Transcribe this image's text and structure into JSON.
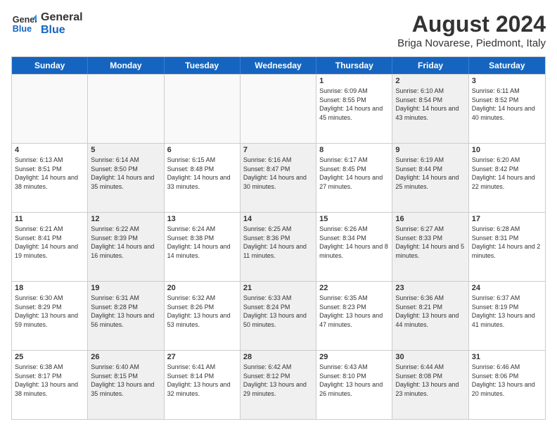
{
  "logo": {
    "line1": "General",
    "line2": "Blue"
  },
  "title": "August 2024",
  "subtitle": "Briga Novarese, Piedmont, Italy",
  "header_days": [
    "Sunday",
    "Monday",
    "Tuesday",
    "Wednesday",
    "Thursday",
    "Friday",
    "Saturday"
  ],
  "rows": [
    [
      {
        "day": "",
        "info": "",
        "shaded": false,
        "empty": true
      },
      {
        "day": "",
        "info": "",
        "shaded": false,
        "empty": true
      },
      {
        "day": "",
        "info": "",
        "shaded": false,
        "empty": true
      },
      {
        "day": "",
        "info": "",
        "shaded": false,
        "empty": true
      },
      {
        "day": "1",
        "info": "Sunrise: 6:09 AM\nSunset: 8:55 PM\nDaylight: 14 hours and 45 minutes.",
        "shaded": false,
        "empty": false
      },
      {
        "day": "2",
        "info": "Sunrise: 6:10 AM\nSunset: 8:54 PM\nDaylight: 14 hours and 43 minutes.",
        "shaded": true,
        "empty": false
      },
      {
        "day": "3",
        "info": "Sunrise: 6:11 AM\nSunset: 8:52 PM\nDaylight: 14 hours and 40 minutes.",
        "shaded": false,
        "empty": false
      }
    ],
    [
      {
        "day": "4",
        "info": "Sunrise: 6:13 AM\nSunset: 8:51 PM\nDaylight: 14 hours and 38 minutes.",
        "shaded": false,
        "empty": false
      },
      {
        "day": "5",
        "info": "Sunrise: 6:14 AM\nSunset: 8:50 PM\nDaylight: 14 hours and 35 minutes.",
        "shaded": true,
        "empty": false
      },
      {
        "day": "6",
        "info": "Sunrise: 6:15 AM\nSunset: 8:48 PM\nDaylight: 14 hours and 33 minutes.",
        "shaded": false,
        "empty": false
      },
      {
        "day": "7",
        "info": "Sunrise: 6:16 AM\nSunset: 8:47 PM\nDaylight: 14 hours and 30 minutes.",
        "shaded": true,
        "empty": false
      },
      {
        "day": "8",
        "info": "Sunrise: 6:17 AM\nSunset: 8:45 PM\nDaylight: 14 hours and 27 minutes.",
        "shaded": false,
        "empty": false
      },
      {
        "day": "9",
        "info": "Sunrise: 6:19 AM\nSunset: 8:44 PM\nDaylight: 14 hours and 25 minutes.",
        "shaded": true,
        "empty": false
      },
      {
        "day": "10",
        "info": "Sunrise: 6:20 AM\nSunset: 8:42 PM\nDaylight: 14 hours and 22 minutes.",
        "shaded": false,
        "empty": false
      }
    ],
    [
      {
        "day": "11",
        "info": "Sunrise: 6:21 AM\nSunset: 8:41 PM\nDaylight: 14 hours and 19 minutes.",
        "shaded": false,
        "empty": false
      },
      {
        "day": "12",
        "info": "Sunrise: 6:22 AM\nSunset: 8:39 PM\nDaylight: 14 hours and 16 minutes.",
        "shaded": true,
        "empty": false
      },
      {
        "day": "13",
        "info": "Sunrise: 6:24 AM\nSunset: 8:38 PM\nDaylight: 14 hours and 14 minutes.",
        "shaded": false,
        "empty": false
      },
      {
        "day": "14",
        "info": "Sunrise: 6:25 AM\nSunset: 8:36 PM\nDaylight: 14 hours and 11 minutes.",
        "shaded": true,
        "empty": false
      },
      {
        "day": "15",
        "info": "Sunrise: 6:26 AM\nSunset: 8:34 PM\nDaylight: 14 hours and 8 minutes.",
        "shaded": false,
        "empty": false
      },
      {
        "day": "16",
        "info": "Sunrise: 6:27 AM\nSunset: 8:33 PM\nDaylight: 14 hours and 5 minutes.",
        "shaded": true,
        "empty": false
      },
      {
        "day": "17",
        "info": "Sunrise: 6:28 AM\nSunset: 8:31 PM\nDaylight: 14 hours and 2 minutes.",
        "shaded": false,
        "empty": false
      }
    ],
    [
      {
        "day": "18",
        "info": "Sunrise: 6:30 AM\nSunset: 8:29 PM\nDaylight: 13 hours and 59 minutes.",
        "shaded": false,
        "empty": false
      },
      {
        "day": "19",
        "info": "Sunrise: 6:31 AM\nSunset: 8:28 PM\nDaylight: 13 hours and 56 minutes.",
        "shaded": true,
        "empty": false
      },
      {
        "day": "20",
        "info": "Sunrise: 6:32 AM\nSunset: 8:26 PM\nDaylight: 13 hours and 53 minutes.",
        "shaded": false,
        "empty": false
      },
      {
        "day": "21",
        "info": "Sunrise: 6:33 AM\nSunset: 8:24 PM\nDaylight: 13 hours and 50 minutes.",
        "shaded": true,
        "empty": false
      },
      {
        "day": "22",
        "info": "Sunrise: 6:35 AM\nSunset: 8:23 PM\nDaylight: 13 hours and 47 minutes.",
        "shaded": false,
        "empty": false
      },
      {
        "day": "23",
        "info": "Sunrise: 6:36 AM\nSunset: 8:21 PM\nDaylight: 13 hours and 44 minutes.",
        "shaded": true,
        "empty": false
      },
      {
        "day": "24",
        "info": "Sunrise: 6:37 AM\nSunset: 8:19 PM\nDaylight: 13 hours and 41 minutes.",
        "shaded": false,
        "empty": false
      }
    ],
    [
      {
        "day": "25",
        "info": "Sunrise: 6:38 AM\nSunset: 8:17 PM\nDaylight: 13 hours and 38 minutes.",
        "shaded": false,
        "empty": false
      },
      {
        "day": "26",
        "info": "Sunrise: 6:40 AM\nSunset: 8:15 PM\nDaylight: 13 hours and 35 minutes.",
        "shaded": true,
        "empty": false
      },
      {
        "day": "27",
        "info": "Sunrise: 6:41 AM\nSunset: 8:14 PM\nDaylight: 13 hours and 32 minutes.",
        "shaded": false,
        "empty": false
      },
      {
        "day": "28",
        "info": "Sunrise: 6:42 AM\nSunset: 8:12 PM\nDaylight: 13 hours and 29 minutes.",
        "shaded": true,
        "empty": false
      },
      {
        "day": "29",
        "info": "Sunrise: 6:43 AM\nSunset: 8:10 PM\nDaylight: 13 hours and 26 minutes.",
        "shaded": false,
        "empty": false
      },
      {
        "day": "30",
        "info": "Sunrise: 6:44 AM\nSunset: 8:08 PM\nDaylight: 13 hours and 23 minutes.",
        "shaded": true,
        "empty": false
      },
      {
        "day": "31",
        "info": "Sunrise: 6:46 AM\nSunset: 8:06 PM\nDaylight: 13 hours and 20 minutes.",
        "shaded": false,
        "empty": false
      }
    ]
  ]
}
